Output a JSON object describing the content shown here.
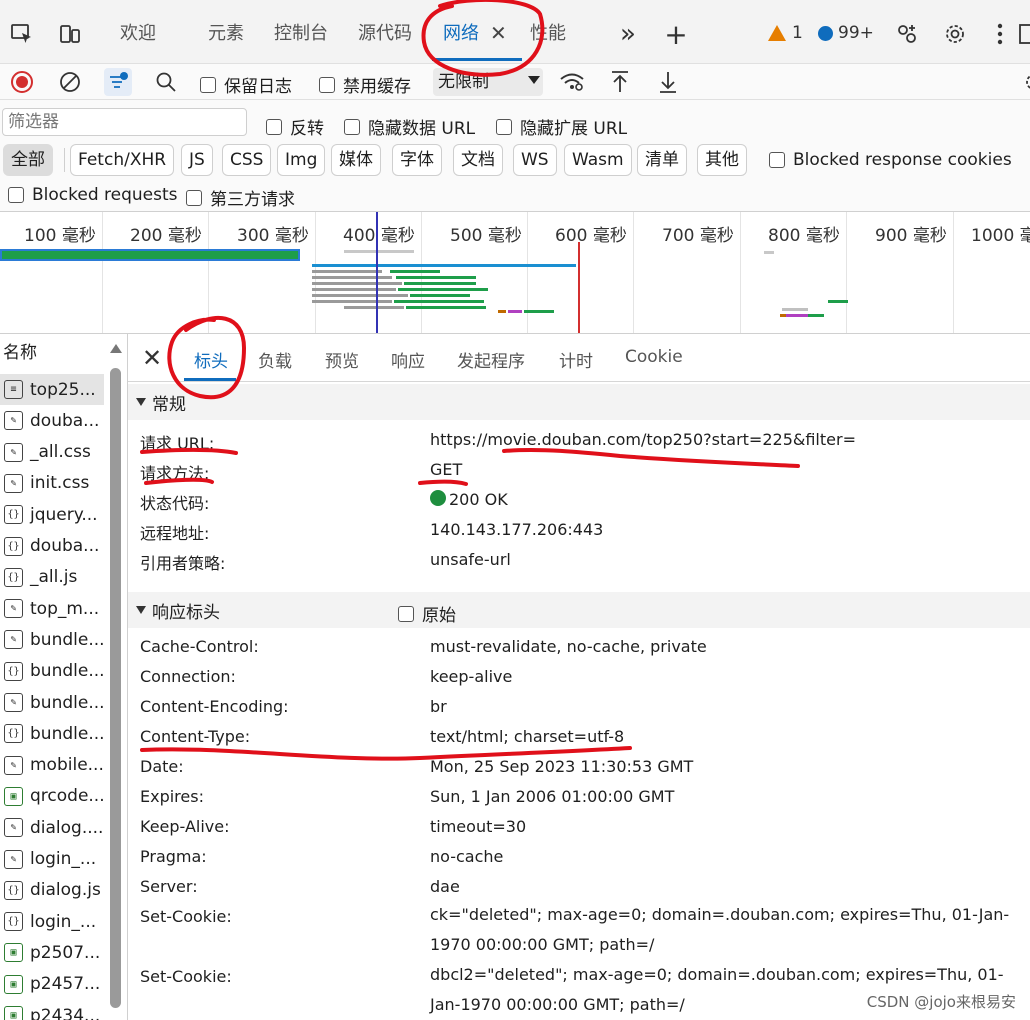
{
  "tabbar": {
    "tabs": [
      "欢迎",
      "元素",
      "控制台",
      "源代码",
      "网络",
      "性能"
    ],
    "active_tab": "网络",
    "warnings_count": "1",
    "messages_count": "99+",
    "close_glyph": "✕",
    "more_glyph": "»",
    "add_glyph": "+"
  },
  "toolbar": {
    "preserve_log": "保留日志",
    "disable_cache": "禁用缓存",
    "throttle_value": "无限制"
  },
  "filter": {
    "placeholder": "筛选器",
    "invert": "反转",
    "hide_data_urls": "隐藏数据 URL",
    "hide_extension_urls": "隐藏扩展 URL",
    "types": [
      "全部",
      "Fetch/XHR",
      "JS",
      "CSS",
      "Img",
      "媒体",
      "字体",
      "文档",
      "WS",
      "Wasm",
      "清单",
      "其他"
    ],
    "selected_type": "全部",
    "blocked_response_cookies": "Blocked response cookies",
    "blocked_requests": "Blocked requests",
    "third_party": "第三方请求"
  },
  "timeline": {
    "ticks": [
      "100 毫秒",
      "200 毫秒",
      "300 毫秒",
      "400 毫秒",
      "500 毫秒",
      "600 毫秒",
      "700 毫秒",
      "800 毫秒",
      "900 毫秒",
      "1000 毫秒"
    ]
  },
  "namecol": {
    "header": "名称",
    "rows": [
      {
        "name": "top25...",
        "icon": "doc-icon"
      },
      {
        "name": "douba...",
        "icon": "css-icon"
      },
      {
        "name": "_all.css",
        "icon": "css-icon"
      },
      {
        "name": "init.css",
        "icon": "css-icon"
      },
      {
        "name": "jquery...",
        "icon": "js-icon"
      },
      {
        "name": "douba...",
        "icon": "js-icon"
      },
      {
        "name": "_all.js",
        "icon": "js-icon"
      },
      {
        "name": "top_m...",
        "icon": "css-icon"
      },
      {
        "name": "bundle...",
        "icon": "css-icon"
      },
      {
        "name": "bundle...",
        "icon": "js-icon"
      },
      {
        "name": "bundle...",
        "icon": "css-icon"
      },
      {
        "name": "bundle...",
        "icon": "js-icon"
      },
      {
        "name": "mobile...",
        "icon": "css-icon"
      },
      {
        "name": "qrcode...",
        "icon": "image-icon"
      },
      {
        "name": "dialog....",
        "icon": "css-icon"
      },
      {
        "name": "login_...",
        "icon": "css-icon"
      },
      {
        "name": "dialog.js",
        "icon": "js-icon"
      },
      {
        "name": "login_...",
        "icon": "js-icon"
      },
      {
        "name": "p2507...",
        "icon": "image-icon"
      },
      {
        "name": "p2457...",
        "icon": "image-icon"
      },
      {
        "name": "p2434...",
        "icon": "image-icon"
      }
    ]
  },
  "detail": {
    "tabs": [
      "标头",
      "负载",
      "预览",
      "响应",
      "发起程序",
      "计时",
      "Cookie"
    ],
    "active_tab": "标头",
    "general": {
      "title": "常规",
      "rows": [
        {
          "key": "请求 URL:",
          "value": "https://movie.douban.com/top250?start=225&filter="
        },
        {
          "key": "请求方法:",
          "value": "GET"
        },
        {
          "key": "状态代码:",
          "value": "200 OK"
        },
        {
          "key": "远程地址:",
          "value": "140.143.177.206:443"
        },
        {
          "key": "引用者策略:",
          "value": "unsafe-url"
        }
      ]
    },
    "response_headers": {
      "title": "响应标头",
      "raw_label": "原始",
      "rows": [
        {
          "key": "Cache-Control:",
          "value": "must-revalidate, no-cache, private"
        },
        {
          "key": "Connection:",
          "value": "keep-alive"
        },
        {
          "key": "Content-Encoding:",
          "value": "br"
        },
        {
          "key": "Content-Type:",
          "value": "text/html; charset=utf-8"
        },
        {
          "key": "Date:",
          "value": "Mon, 25 Sep 2023 11:30:53 GMT"
        },
        {
          "key": "Expires:",
          "value": "Sun, 1 Jan 2006 01:00:00 GMT"
        },
        {
          "key": "Keep-Alive:",
          "value": "timeout=30"
        },
        {
          "key": "Pragma:",
          "value": "no-cache"
        },
        {
          "key": "Server:",
          "value": "dae"
        },
        {
          "key": "Set-Cookie:",
          "value": "ck=\"deleted\"; max-age=0; domain=.douban.com; expires=Thu, 01-Jan-1970 00:00:00 GMT; path=/"
        },
        {
          "key": "Set-Cookie:",
          "value": "dbcl2=\"deleted\"; max-age=0; domain=.douban.com; expires=Thu, 01-Jan-1970 00:00:00 GMT; path=/"
        }
      ]
    }
  },
  "watermark": "CSDN @jojo来根易安",
  "colors": {
    "accent": "#0f6cbd",
    "annotation_red": "#e0101a",
    "status_ok": "#1e8e3e",
    "warning": "#e67e00"
  }
}
